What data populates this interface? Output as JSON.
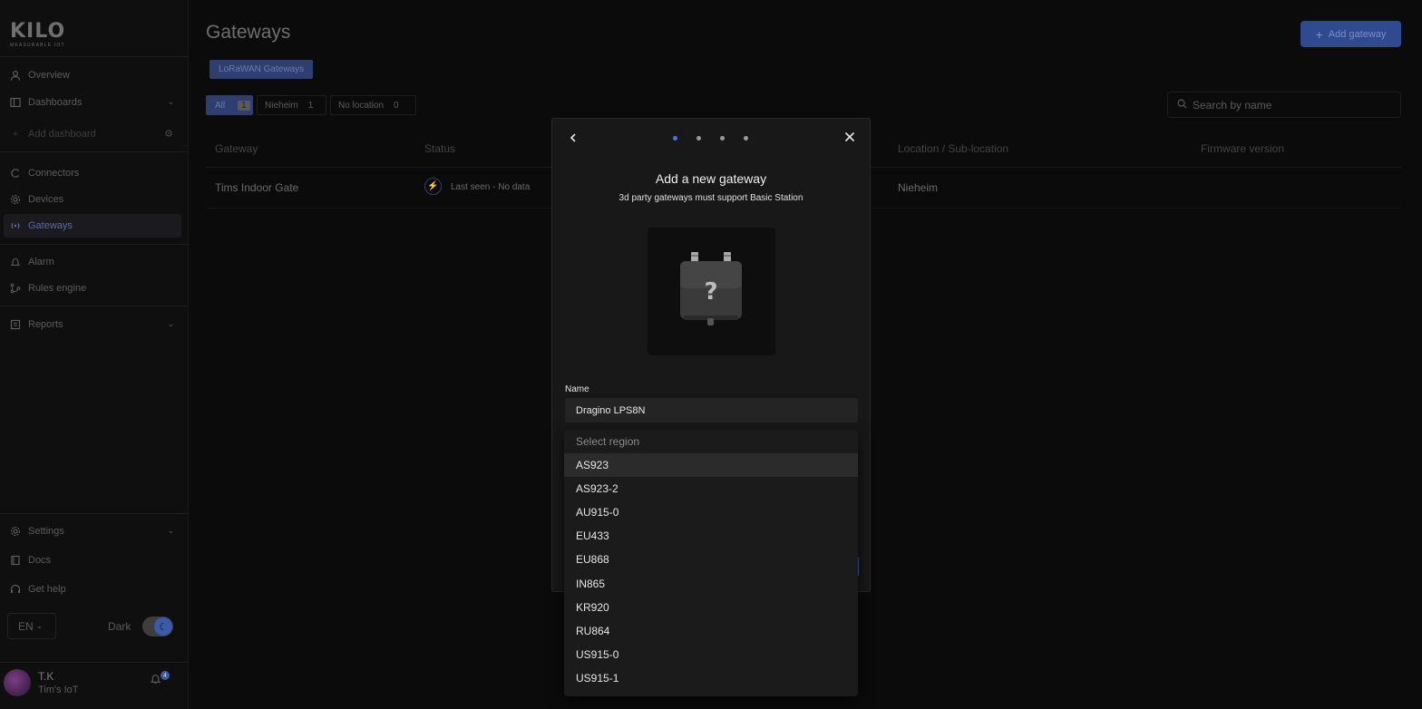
{
  "sidebar": {
    "logo": "KILO",
    "logo_sub": "MEASURABLE IOT",
    "items": [
      {
        "label": "Overview",
        "icon": "person-icon"
      },
      {
        "label": "Dashboards",
        "icon": "dashboard-icon"
      },
      {
        "label": "Add dashboard",
        "icon": "plus-icon"
      },
      {
        "label": "Connectors",
        "icon": "connector-icon"
      },
      {
        "label": "Devices",
        "icon": "gear-icon"
      },
      {
        "label": "Gateways",
        "icon": "antenna-icon"
      },
      {
        "label": "Alarm",
        "icon": "bell-icon"
      },
      {
        "label": "Rules engine",
        "icon": "flow-icon"
      },
      {
        "label": "Reports",
        "icon": "report-icon"
      },
      {
        "label": "Settings",
        "icon": "settings-icon"
      },
      {
        "label": "Docs",
        "icon": "book-icon"
      },
      {
        "label": "Get help",
        "icon": "help-icon"
      }
    ],
    "language": "EN",
    "dark_label": "Dark",
    "user_name": "T.K",
    "user_org": "Tim's IoT",
    "notification_count": "4"
  },
  "header": {
    "title": "Gateways",
    "add_label": "Add gateway",
    "tab": "LoRaWAN Gateways"
  },
  "filters": [
    {
      "label": "All",
      "count": "1"
    },
    {
      "label": "Nieheim",
      "count": "1"
    },
    {
      "label": "No location",
      "count": "0"
    }
  ],
  "search": {
    "placeholder": "Search by name"
  },
  "table": {
    "columns": [
      "Gateway",
      "Status",
      "Location / Sub-location",
      "Firmware version"
    ],
    "rows": [
      {
        "gateway": "Tims Indoor Gate",
        "status": "Last seen - No data",
        "location": "Nieheim",
        "firmware": ""
      }
    ]
  },
  "modal": {
    "title": "Add a new gateway",
    "subtitle": "3d party gateways must support Basic Station",
    "name_label": "Name",
    "name_value": "Dragino LPS8N",
    "step_count": 4,
    "active_step": 1
  },
  "dropdown": {
    "placeholder": "Select region",
    "options": [
      "AS923",
      "AS923-2",
      "AU915-0",
      "EU433",
      "EU868",
      "IN865",
      "KR920",
      "RU864",
      "US915-0",
      "US915-1"
    ],
    "highlighted": "AS923"
  },
  "colors": {
    "accent": "#3b5ba8",
    "active_dot": "#4f74d9",
    "background": "#0b0b0c",
    "modal": "#181818"
  }
}
